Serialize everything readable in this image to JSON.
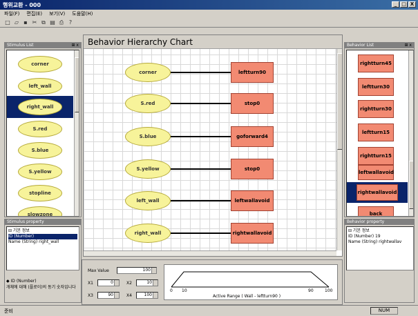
{
  "window": {
    "title": "행위교환 - 000",
    "btn_min": "_",
    "btn_max": "□",
    "btn_close": "X"
  },
  "menu": [
    "파일(F)",
    "편집(E)",
    "보기(V)",
    "도움말(H)"
  ],
  "stimulus_panel": {
    "title": "Stimulus List",
    "close": "⊞ x",
    "items": [
      "corner",
      "left_wall",
      "right_wall",
      "S.red",
      "S.blue",
      "S.yellow",
      "stopline",
      "slowzone"
    ],
    "selected_index": 2
  },
  "stimulus_props": {
    "title": "Stimulus property",
    "rows": [
      "⊟ 기본 정보",
      "ID (Number)",
      "Name (String)   right_wall"
    ],
    "bottom_rows": [
      "◆ ID (Number)",
      "개체에 대해 (플로이)의 동기 숫자입니다"
    ]
  },
  "canvas": {
    "title": "Behavior Hierarchy Chart",
    "pairs": [
      {
        "stimulus": "corner",
        "behavior": "leftturn90"
      },
      {
        "stimulus": "S.red",
        "behavior": "stop0"
      },
      {
        "stimulus": "S.blue",
        "behavior": "goforward4"
      },
      {
        "stimulus": "S.yellow",
        "behavior": "stop0"
      },
      {
        "stimulus": "left_wall",
        "behavior": "leftwallavoid"
      },
      {
        "stimulus": "right_wall",
        "behavior": "rightwallavoid"
      }
    ]
  },
  "controls": {
    "max_value_label": "Max Value",
    "max_value": "100",
    "x1_label": "X1",
    "x1": "0",
    "x2_label": "X2",
    "x2": "10",
    "x3_label": "X3",
    "x3": "90",
    "x4_label": "X4",
    "x4": "100",
    "range_caption": "Active Range ( Wall - leftturn90 )",
    "range_ticks": [
      "0",
      "10",
      "90",
      "100"
    ]
  },
  "behavior_panel": {
    "title": "Behavior List",
    "close": "⊞ x",
    "items": [
      "rightturn45",
      "leftturn30",
      "rightturn30",
      "leftturn15",
      "rightturn15",
      "leftwallavoid",
      "rightwallavoid",
      "back"
    ],
    "selected_index": 6
  },
  "behavior_props": {
    "title": "Behavior property",
    "rows": [
      "⊟ 기본 정보",
      "ID (Number)   19",
      "Name (String)   rightwallav"
    ]
  },
  "status": {
    "left": "준비",
    "right": "NUM"
  },
  "colors": {
    "ellipse": "#f7f39a",
    "rect": "#f28a72",
    "select": "#0a246a"
  }
}
